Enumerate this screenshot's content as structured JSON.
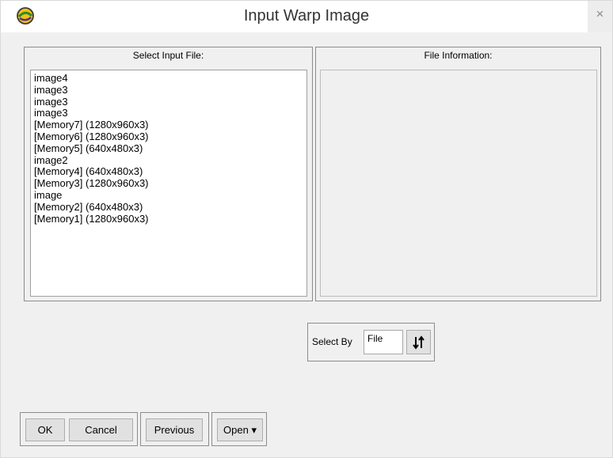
{
  "window": {
    "title": "Input Warp Image",
    "close_glyph": "×",
    "icon": "app-logo-icon"
  },
  "input_panel": {
    "header": "Select Input File:",
    "items": [
      "image4",
      "image3",
      "image3",
      "image3",
      "[Memory7] (1280x960x3)",
      "[Memory6] (1280x960x3)",
      "[Memory5] (640x480x3)",
      "image2",
      "[Memory4] (640x480x3)",
      "[Memory3] (1280x960x3)",
      "image",
      "[Memory2] (640x480x3)",
      "[Memory1] (1280x960x3)"
    ]
  },
  "info_panel": {
    "header": "File Information:"
  },
  "select_by": {
    "label": "Select By",
    "value": "File",
    "sort_icon": "sort-updown-icon"
  },
  "buttons": {
    "ok": "OK",
    "cancel": "Cancel",
    "previous": "Previous",
    "open": "Open",
    "open_arrow": "▾"
  }
}
